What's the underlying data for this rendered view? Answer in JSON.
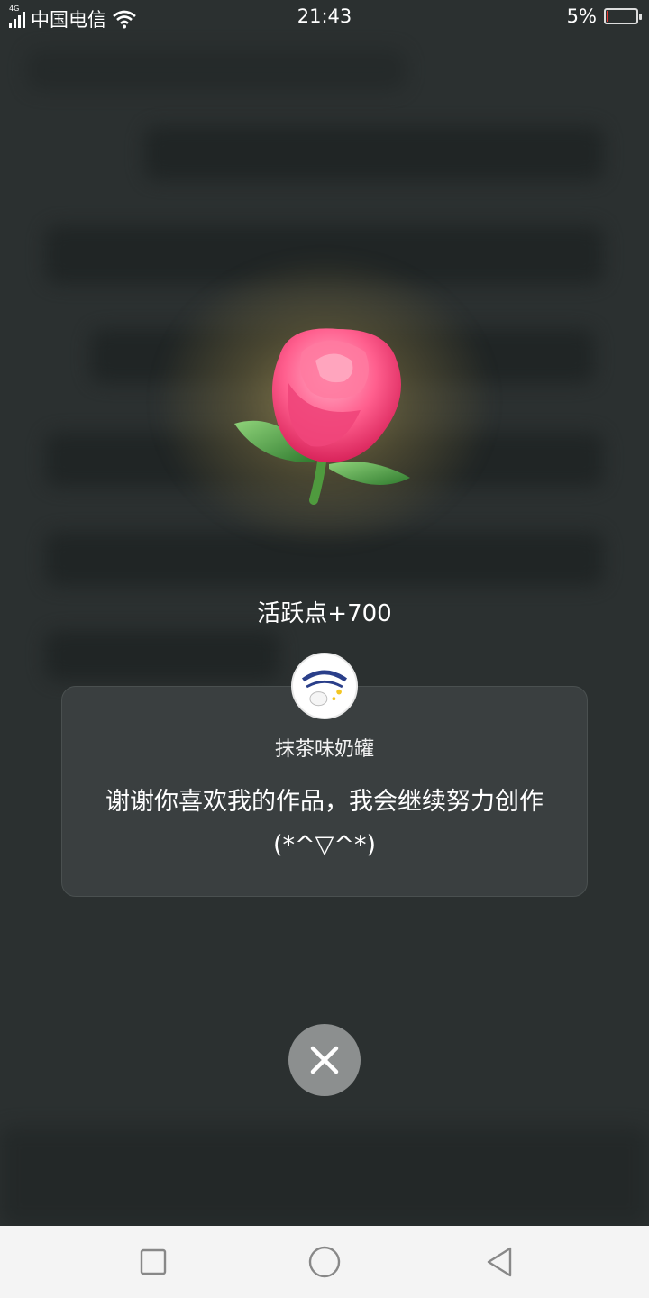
{
  "status_bar": {
    "network_tag": "4G",
    "carrier": "中国电信",
    "time": "21:43",
    "battery_percent": "5%",
    "battery_level": 0.05,
    "battery_color": "#e53935"
  },
  "gift": {
    "icon": "rose-icon",
    "reward_text": "活跃点+700"
  },
  "card": {
    "author_name": "抹茶味奶罐",
    "message": "谢谢你喜欢我的作品，我会继续努力创作(*^▽^*)"
  },
  "close_button": {
    "icon": "close-icon"
  },
  "nav_bar": {
    "recent_icon": "square-icon",
    "home_icon": "circle-icon",
    "back_icon": "triangle-back-icon"
  }
}
